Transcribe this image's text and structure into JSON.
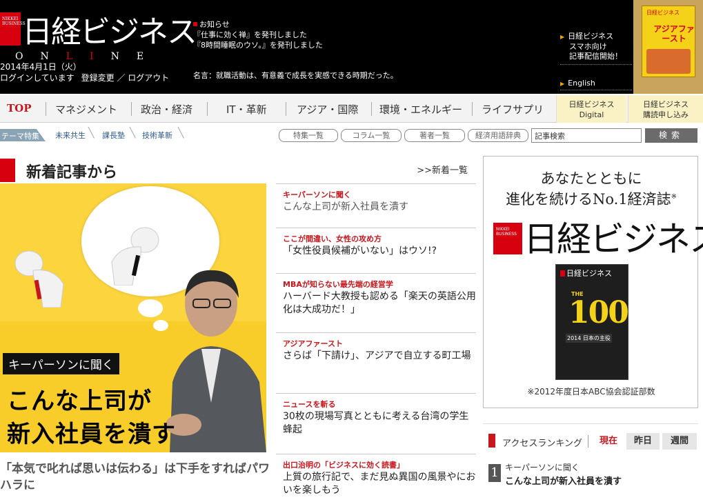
{
  "header": {
    "logo_top": "NIKKEI BUSINESS",
    "logo_name": "日経ビジネス",
    "online_letters": [
      "O",
      "N",
      "L",
      "I",
      "N",
      "E"
    ],
    "date": "2014年4月1日（火）",
    "login_status": "ログインしています",
    "login_links": "登録変更 ／ ログアウト",
    "news_title": "お知らせ",
    "news_items": [
      "『仕事に効く禅』を発刊しました",
      "『8時間睡眠のウソ。』を発刊しました"
    ],
    "maxim": "名言：就職活動は、有意義で成長を実感できる時期だった。",
    "promo_lines": [
      "日経ビジネス",
      "スマホ向け",
      "記事配信開始！"
    ],
    "english": "English",
    "book_label": "日経ビジネス",
    "book_title": "アジアファースト"
  },
  "nav": {
    "items": [
      "TOP",
      "マネジメント",
      "政治・経済",
      "IT・革新",
      "アジア・国際",
      "環境・エネルギー",
      "ライフサプリ"
    ],
    "digital": [
      "日経ビジネス",
      "Digital"
    ],
    "subscribe": [
      "日経ビジネス",
      "購読申し込み"
    ]
  },
  "subbar": {
    "theme_label": "テーマ特集",
    "theme_links": [
      "未来共生",
      "課長塾",
      "技術革新"
    ],
    "pills": [
      "特集一覧",
      "コラム一覧",
      "著者一覧",
      "経済用語辞典"
    ],
    "search_value": "記事検索",
    "search_button": "検索"
  },
  "main": {
    "section_title": "新着記事から",
    "more_link": ">>新着一覧",
    "feature": {
      "caption": "キーパーソンに聞く",
      "headline1": "こんな上司が",
      "headline2": "新入社員を潰す"
    },
    "lead": "「本気で叱れば思いは伝わる」は下手をすればパワハラに",
    "articles": [
      {
        "cat": "キーパーソンに聞く",
        "title": "こんな上司が新入社員を潰す"
      },
      {
        "cat": "ここが間違い、女性の攻め方",
        "title": "「女性役員候補がいない」はウソ!?"
      },
      {
        "cat": "MBAが知らない最先端の経営学",
        "title": "ハーバード大教授も認める「楽天の英語公用化は大成功だ！」"
      },
      {
        "cat": "アジアファースト",
        "title": "さらば「下請け」、アジアで自立する町工場"
      },
      {
        "cat": "ニュースを斬る",
        "title": "30枚の現場写真とともに考える台湾の学生蜂起"
      },
      {
        "cat": "出口治明の「ビジネスに効く読書」",
        "title": "上質の旅行記で、まだ見ぬ異国の風景やにおいを楽しもう"
      }
    ]
  },
  "ad": {
    "copy1": "あなたとともに",
    "copy2": "進化を続けるNo.1経済誌",
    "copy2_mark": "※",
    "logo_small": "NIKKEI BUSINESS",
    "logo": "日経ビジネス",
    "mag_title": "日経ビジネス",
    "mag_the": "THE",
    "mag_100": "100",
    "mag_year": "2014 日本の主役",
    "note": "※2012年度日本ABC協会認証部数"
  },
  "ranking": {
    "label": "アクセスランキング",
    "tabs": [
      "現在",
      "昨日",
      "週間"
    ],
    "items": [
      {
        "num": "1",
        "cat": "キーパーソンに聞く",
        "title": "こんな上司が新入社員を潰す"
      }
    ]
  },
  "colors": {
    "brand_red": "#d7000f",
    "header_bg": "#000000",
    "feature_bg": "#fbd43e"
  },
  "icons": [
    "notice-square-icon",
    "arrow-right-icon",
    "ranking-bar-icon"
  ]
}
